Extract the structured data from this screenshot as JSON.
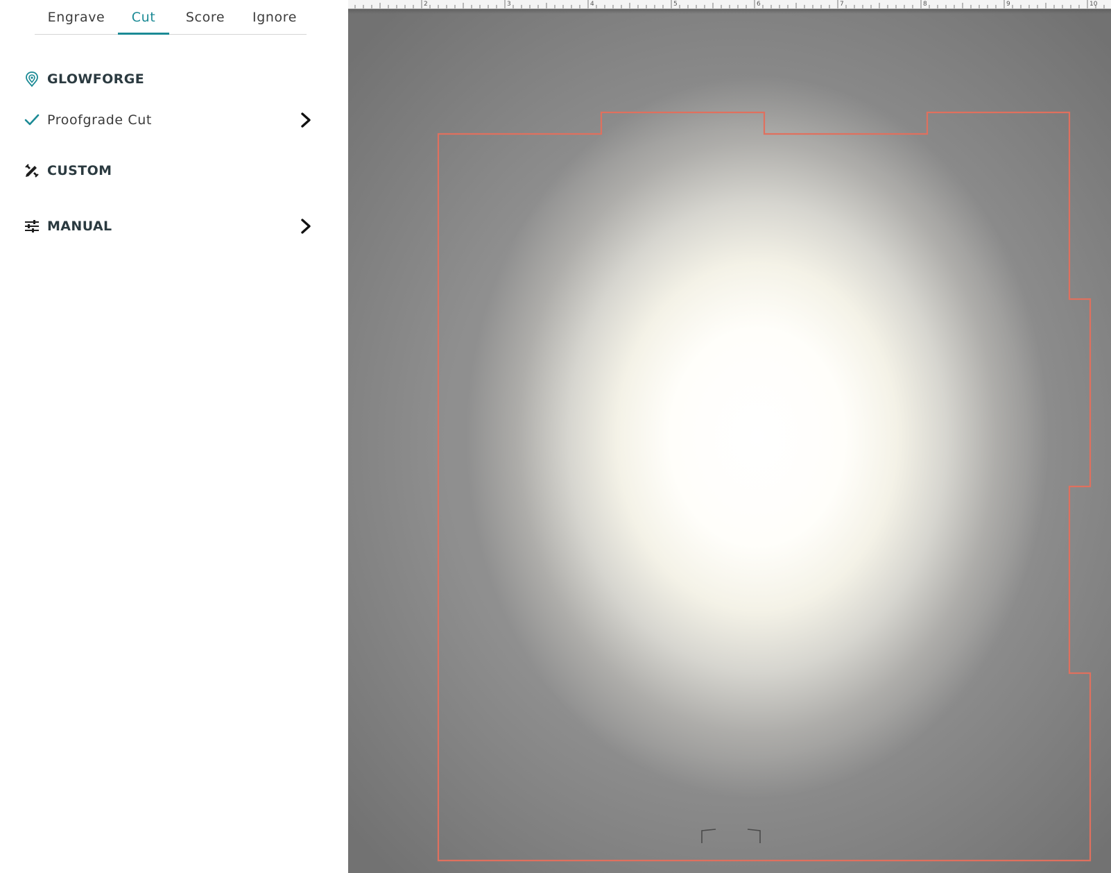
{
  "tabs": [
    {
      "label": "Engrave",
      "active": false
    },
    {
      "label": "Cut",
      "active": true
    },
    {
      "label": "Score",
      "active": false
    },
    {
      "label": "Ignore",
      "active": false
    }
  ],
  "sections": {
    "glowforge": {
      "title": "GLOWFORGE",
      "icon": "glowforge-pin-icon",
      "items": [
        {
          "label": "Proofgrade Cut",
          "selected": true,
          "icon": "checkmark-icon"
        }
      ]
    },
    "custom": {
      "title": "CUSTOM",
      "icon": "pencil-ruler-icon"
    },
    "manual": {
      "title": "MANUAL",
      "icon": "sliders-icon"
    }
  },
  "ruler": {
    "labels": [
      "2",
      "3",
      "4",
      "5",
      "6",
      "7",
      "8",
      "9",
      "10"
    ]
  },
  "colors": {
    "accent": "#1b8a95",
    "cut_line": "#e0705e",
    "panel_text": "#2b3a40"
  }
}
